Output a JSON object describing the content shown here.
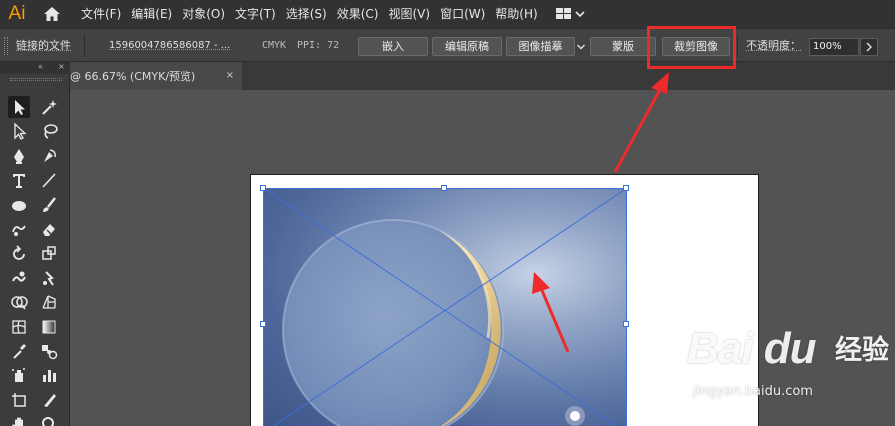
{
  "app": {
    "logo_text": "Ai"
  },
  "menu": {
    "items": [
      "文件(F)",
      "编辑(E)",
      "对象(O)",
      "文字(T)",
      "选择(S)",
      "效果(C)",
      "视图(V)",
      "窗口(W)",
      "帮助(H)"
    ]
  },
  "control_bar": {
    "linked_file_label": "链接的文件",
    "file_name": "1596004786586087 - ...",
    "color_mode": "CMYK",
    "ppi": "PPI: 72",
    "embed_label": "嵌入",
    "edit_original_label": "编辑原稿",
    "image_trace_label": "图像描摹",
    "mask_label": "蒙版",
    "crop_image_label": "裁剪图像",
    "opacity_label": "不透明度：",
    "opacity_value": "100%"
  },
  "document_tab": {
    "title": "@ 66.67% (CMYK/预览)",
    "close_glyph": "×"
  },
  "toolbar": {
    "collapse_glyph": "«",
    "close_glyph": "×",
    "tools": [
      "selection-tool",
      "magic-wand-tool",
      "direct-selection-tool",
      "lasso-tool",
      "pen-tool",
      "curvature-tool",
      "type-tool",
      "line-segment-tool",
      "ellipse-tool",
      "paintbrush-tool",
      "shaper-tool",
      "eraser-tool",
      "rotate-tool",
      "scale-tool",
      "warp-tool",
      "puppet-warp-tool",
      "shape-builder-tool",
      "perspective-grid-tool",
      "mesh-tool",
      "gradient-tool",
      "eyedropper-tool",
      "blend-tool",
      "symbol-sprayer-tool",
      "column-graph-tool",
      "artboard-tool",
      "slice-tool",
      "hand-tool",
      "zoom-tool"
    ]
  },
  "watermark": {
    "logo_text": "Bai du",
    "jingyan_text": "经验",
    "url": "jingyan.baidu.com"
  },
  "colors": {
    "annotation_red": "#ee2b2b",
    "selection_blue": "#3d6fd8",
    "ai_orange": "#ff9a00"
  }
}
